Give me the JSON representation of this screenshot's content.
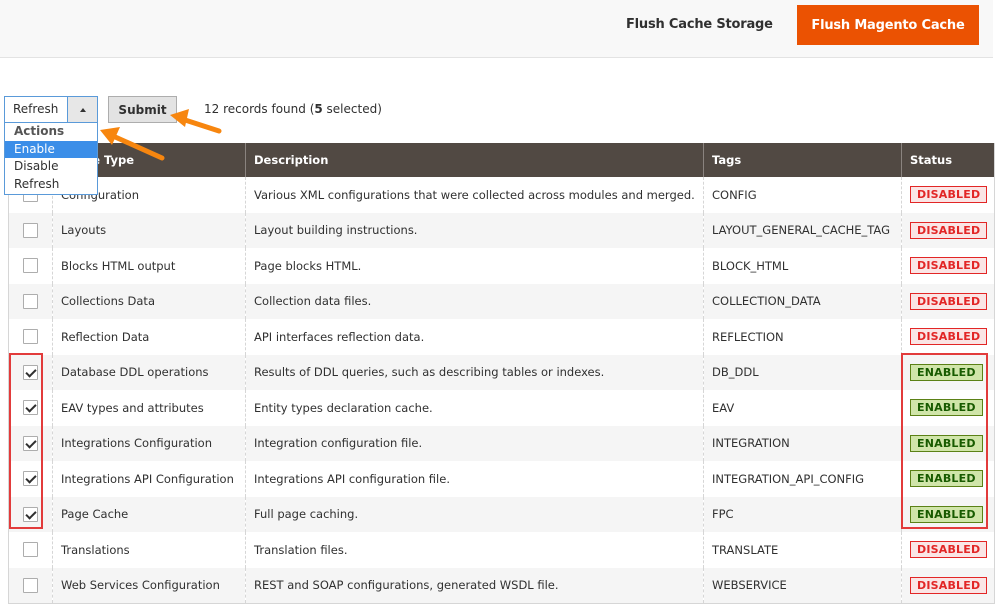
{
  "header": {
    "flush_storage_label": "Flush Cache Storage",
    "flush_magento_label": "Flush Magento Cache"
  },
  "mass_action": {
    "selected": "Refresh",
    "options": [
      {
        "label": "Actions",
        "group": true
      },
      {
        "label": "Enable",
        "highlighted": true
      },
      {
        "label": "Disable"
      },
      {
        "label": "Refresh"
      }
    ],
    "submit_label": "Submit"
  },
  "records": {
    "prefix": "12 records found (",
    "selected_count": "5",
    "suffix": " selected)"
  },
  "table": {
    "columns": [
      "",
      "Cache Type",
      "Description",
      "Tags",
      "Status"
    ],
    "rows": [
      {
        "checked": false,
        "type": "Configuration",
        "description": "Various XML configurations that were collected across modules and merged.",
        "tags": "CONFIG",
        "status": "DISABLED"
      },
      {
        "checked": false,
        "type": "Layouts",
        "description": "Layout building instructions.",
        "tags": "LAYOUT_GENERAL_CACHE_TAG",
        "status": "DISABLED"
      },
      {
        "checked": false,
        "type": "Blocks HTML output",
        "description": "Page blocks HTML.",
        "tags": "BLOCK_HTML",
        "status": "DISABLED"
      },
      {
        "checked": false,
        "type": "Collections Data",
        "description": "Collection data files.",
        "tags": "COLLECTION_DATA",
        "status": "DISABLED"
      },
      {
        "checked": false,
        "type": "Reflection Data",
        "description": "API interfaces reflection data.",
        "tags": "REFLECTION",
        "status": "DISABLED"
      },
      {
        "checked": true,
        "type": "Database DDL operations",
        "description": "Results of DDL queries, such as describing tables or indexes.",
        "tags": "DB_DDL",
        "status": "ENABLED"
      },
      {
        "checked": true,
        "type": "EAV types and attributes",
        "description": "Entity types declaration cache.",
        "tags": "EAV",
        "status": "ENABLED"
      },
      {
        "checked": true,
        "type": "Integrations Configuration",
        "description": "Integration configuration file.",
        "tags": "INTEGRATION",
        "status": "ENABLED"
      },
      {
        "checked": true,
        "type": "Integrations API Configuration",
        "description": "Integrations API configuration file.",
        "tags": "INTEGRATION_API_CONFIG",
        "status": "ENABLED"
      },
      {
        "checked": true,
        "type": "Page Cache",
        "description": "Full page caching.",
        "tags": "FPC",
        "status": "ENABLED"
      },
      {
        "checked": false,
        "type": "Translations",
        "description": "Translation files.",
        "tags": "TRANSLATE",
        "status": "DISABLED"
      },
      {
        "checked": false,
        "type": "Web Services Configuration",
        "description": "REST and SOAP configurations, generated WSDL file.",
        "tags": "WEBSERVICE",
        "status": "DISABLED"
      }
    ]
  },
  "colors": {
    "brand_orange": "#eb5202",
    "header_bg": "#514943",
    "annotation_orange": "#f7860f",
    "annotation_red": "#e23b3b",
    "disabled_red": "#e22626",
    "enabled_green": "#185b00"
  }
}
